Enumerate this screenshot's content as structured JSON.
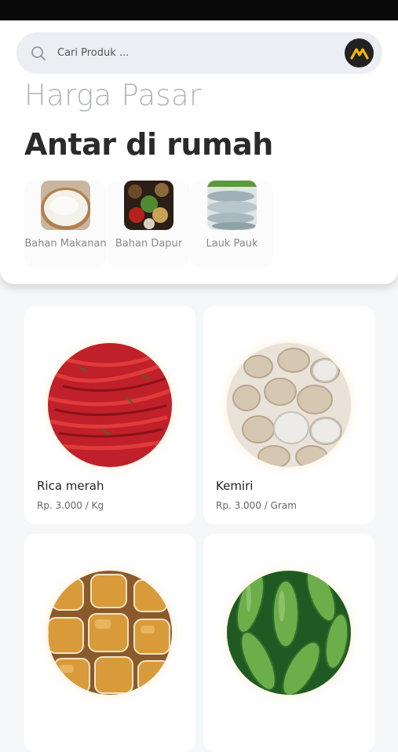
{
  "search": {
    "placeholder": "Cari Produk ..."
  },
  "header": {
    "title_light": "Harga Pasar",
    "title_bold": "Antar di rumah"
  },
  "categories": [
    {
      "label": "Bahan Makanan",
      "icon": "rice-image"
    },
    {
      "label": "Bahan Dapur",
      "icon": "spices-image"
    },
    {
      "label": "Lauk Pauk",
      "icon": "fish-image"
    }
  ],
  "products": [
    {
      "name": "Rica merah",
      "price": "Rp. 3.000 / Kg",
      "image": "red-chili-image"
    },
    {
      "name": "Kemiri",
      "price": "Rp. 3.000 / Gram",
      "image": "candlenut-image"
    },
    {
      "name": "",
      "price": "",
      "image": "cooking-oil-image"
    },
    {
      "name": "",
      "price": "",
      "image": "cucumber-image"
    }
  ],
  "colors": {
    "accent": "#f5b800",
    "logo_bg": "#222222",
    "search_bg": "#eceef3"
  }
}
